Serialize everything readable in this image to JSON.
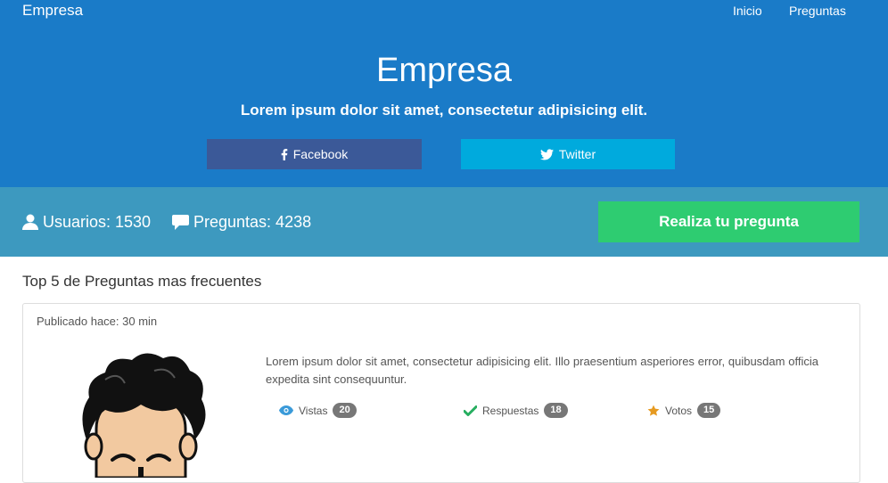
{
  "navbar": {
    "brand": "Empresa",
    "links": [
      "Inicio",
      "Preguntas"
    ]
  },
  "hero": {
    "title": "Empresa",
    "subtitle": "Lorem ipsum dolor sit amet, consectetur adipisicing elit.",
    "facebook_label": "Facebook",
    "twitter_label": "Twitter"
  },
  "stats": {
    "users_label": "Usuarios: 1530",
    "questions_label": "Preguntas: 4238",
    "ask_button": "Realiza tu pregunta"
  },
  "faq": {
    "title": "Top 5 de Preguntas mas frecuentes",
    "question": {
      "meta": "Publicado hace: 30 min",
      "text": "Lorem ipsum dolor sit amet, consectetur adipisicing elit. Illo praesentium asperiores error, quibusdam officia expedita sint consequuntur.",
      "views_label": "Vistas",
      "views_count": "20",
      "answers_label": "Respuestas",
      "answers_count": "18",
      "votes_label": "Votos",
      "votes_count": "15"
    }
  },
  "colors": {
    "hero_bg": "#1a7bc8",
    "stats_bg": "#3d99bf",
    "facebook": "#3b5998",
    "twitter": "#00aadd",
    "ask_button": "#2ecc71"
  },
  "icons": [
    "facebook-icon",
    "twitter-icon",
    "user-icon",
    "comment-icon",
    "eye-icon",
    "check-icon",
    "star-icon"
  ]
}
